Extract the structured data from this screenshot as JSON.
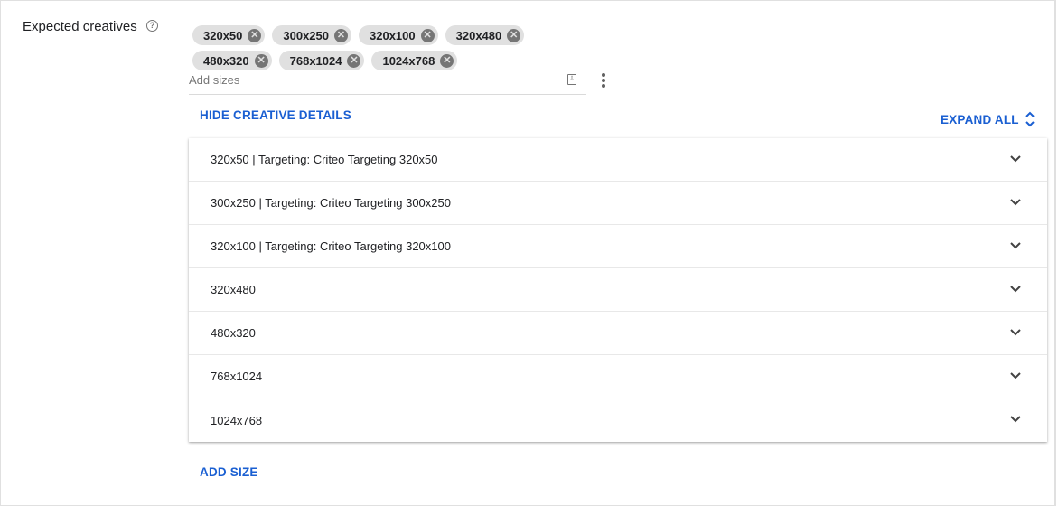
{
  "field": {
    "label": "Expected creatives",
    "help_icon": "help-circle-icon"
  },
  "chips": [
    "320x50",
    "300x250",
    "320x100",
    "320x480",
    "480x320",
    "768x1024",
    "1024x768"
  ],
  "input": {
    "placeholder": "Add sizes"
  },
  "actions": {
    "hide_details": "HIDE CREATIVE DETAILS",
    "expand_all": "EXPAND ALL",
    "add_size": "ADD SIZE"
  },
  "rows": [
    "320x50 | Targeting: Criteo Targeting 320x50",
    "300x250 | Targeting: Criteo Targeting 300x250",
    "320x100 | Targeting: Criteo Targeting 320x100",
    "320x480",
    "480x320",
    "768x1024",
    "1024x768"
  ],
  "colors": {
    "accent": "#1a5fd2",
    "chip_bg": "#e0e0e0"
  }
}
